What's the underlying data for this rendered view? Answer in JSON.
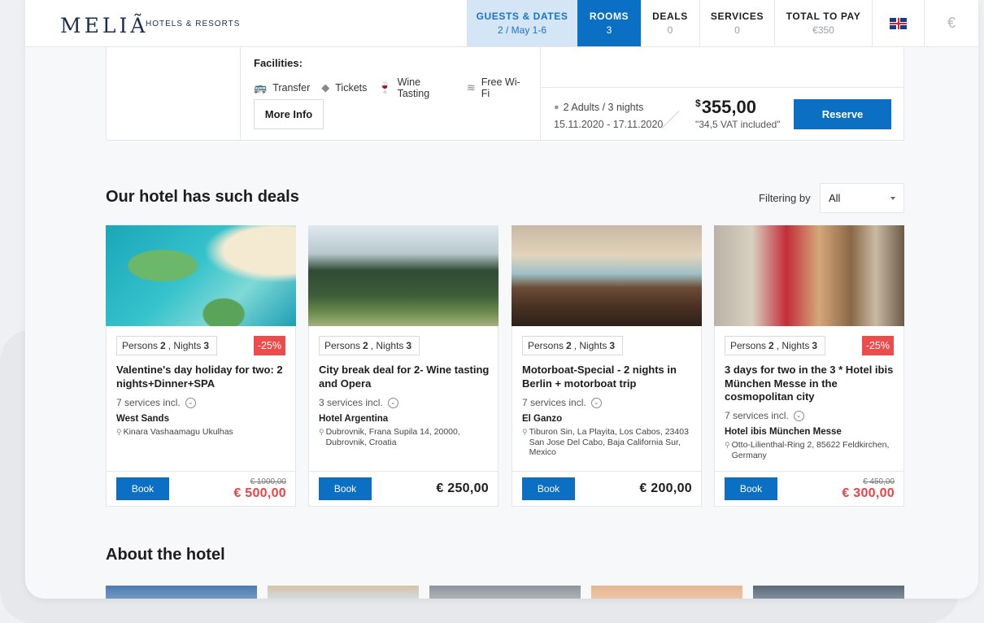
{
  "header": {
    "logo": "MELIÃ",
    "logo_sub": "HOTELS & RESORTS",
    "nav": [
      {
        "title": "GUESTS & DATES",
        "sub": "2 / May 1-6"
      },
      {
        "title": "ROOMS",
        "sub": "3"
      },
      {
        "title": "DEALS",
        "sub": "0"
      },
      {
        "title": "SERVICES",
        "sub": "0"
      },
      {
        "title": "TOTAL TO PAY",
        "sub": "€350"
      }
    ],
    "currency": "€",
    "language_icon": "uk-flag-icon"
  },
  "room": {
    "facilities_title": "Facilities:",
    "facilities": [
      {
        "icon": "bus-icon",
        "label": "Transfer"
      },
      {
        "icon": "ticket-icon",
        "label": "Tickets"
      },
      {
        "icon": "wine-glass-icon",
        "label": "Wine Tasting"
      },
      {
        "icon": "wifi-icon",
        "label": "Free Wi-Fi"
      }
    ],
    "more_info": "More Info",
    "guests": "2 Adults / 3 nights",
    "dates": "15.11.2020 - 17.11.2020",
    "currency_symbol": "$",
    "price": "355,00",
    "vat": "\"34,5 VAT included\"",
    "reserve": "Reserve"
  },
  "deals": {
    "title": "Our hotel has such deals",
    "filter_label": "Filtering by",
    "filter_value": "All",
    "cards": [
      {
        "persons_label": "Persons",
        "persons": "2",
        "nights_label": "Nights",
        "nights": "3",
        "discount": "-25%",
        "title": "Valentine's day holiday for two: 2 nights+Dinner+SPA",
        "services": "7 services incl.",
        "hotel": "West Sands",
        "address": "Kinara Vashaamagu Ukulhas",
        "book": "Book",
        "old_price": "€ 1000,00",
        "price": "€ 500,00"
      },
      {
        "persons_label": "Persons",
        "persons": "2",
        "nights_label": "Nights",
        "nights": "3",
        "discount": "",
        "title": "City break deal for 2- Wine tasting and Opera",
        "services": "3 services incl.",
        "hotel": "Hotel Argentina",
        "address": "Dubrovnik, Frana Supila 14, 20000, Dubrovnik, Croatia",
        "book": "Book",
        "old_price": "",
        "price": "€ 250,00"
      },
      {
        "persons_label": "Persons",
        "persons": "2",
        "nights_label": "Nights",
        "nights": "3",
        "discount": "",
        "title": "Motorboat-Special - 2 nights in Berlin + motorboat trip",
        "services": "7 services incl.",
        "hotel": "El Ganzo",
        "address": "Tiburon Sin, La Playita, Los Cabos, 23403 San Jose Del Cabo, Baja California Sur, Mexico",
        "book": "Book",
        "old_price": "",
        "price": "€ 200,00"
      },
      {
        "persons_label": "Persons",
        "persons": "2",
        "nights_label": "Nights",
        "nights": "3",
        "discount": "-25%",
        "title": "3 days for two in the 3 * Hotel ibis München Messe in the cosmopolitan city",
        "services": "7 services incl.",
        "hotel": "Hotel ibis München Messe",
        "address": "Otto-Lilienthal-Ring 2, 85622 Feldkirchen, Germany",
        "book": "Book",
        "old_price": "€ 450,00",
        "price": "€ 300,00"
      }
    ]
  },
  "about": {
    "title": "About the hotel"
  }
}
